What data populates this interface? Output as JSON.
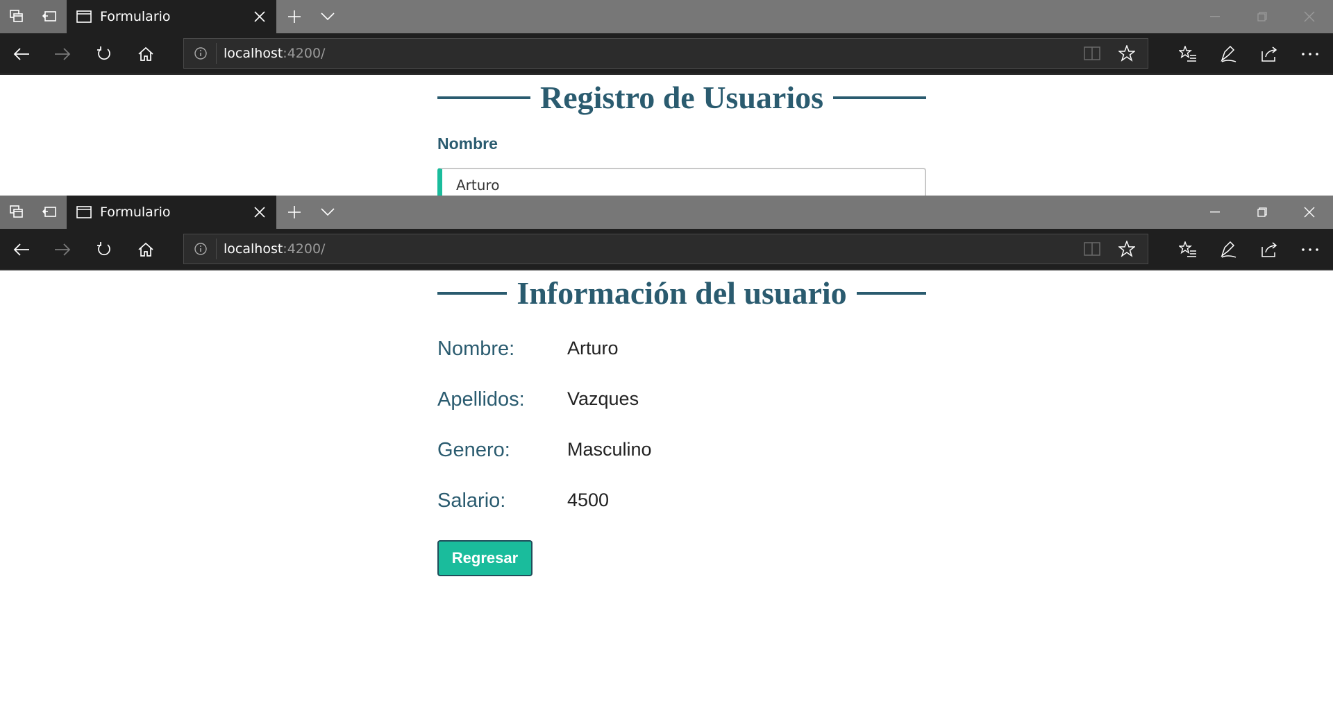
{
  "window_top": {
    "tab": {
      "title": "Formulario"
    },
    "address": {
      "host": "localhost",
      "port_path": ":4200/"
    },
    "page": {
      "heading": "Registro de Usuarios",
      "field_label": "Nombre",
      "field_value": "Arturo"
    }
  },
  "window_bottom": {
    "tab": {
      "title": "Formulario"
    },
    "address": {
      "host": "localhost",
      "port_path": ":4200/"
    },
    "page": {
      "heading": "Información del usuario",
      "rows": [
        {
          "label": "Nombre:",
          "value": "Arturo"
        },
        {
          "label": "Apellidos:",
          "value": "Vazques"
        },
        {
          "label": "Genero:",
          "value": "Masculino"
        },
        {
          "label": "Salario:",
          "value": "4500"
        }
      ],
      "button_label": "Regresar"
    }
  },
  "icons": {
    "tab_actions": "tab-actions-icon",
    "set_aside": "set-aside-tabs-icon",
    "page": "page-icon",
    "close": "close-icon",
    "new_tab": "plus-icon",
    "tab_preview": "chevron-down-icon",
    "back": "back-arrow-icon",
    "forward": "forward-arrow-icon",
    "refresh": "refresh-icon",
    "home": "home-icon",
    "info": "info-icon",
    "reading_view": "reading-view-icon",
    "favorite": "star-icon",
    "favorites_hub": "favorites-list-icon",
    "notes": "pen-icon",
    "share": "share-icon",
    "more": "more-icon"
  },
  "colors": {
    "accent": "#1abc9c",
    "heading": "#2a5b6f",
    "chrome_dark": "#1f1f1f",
    "tabbar": "#777777"
  }
}
